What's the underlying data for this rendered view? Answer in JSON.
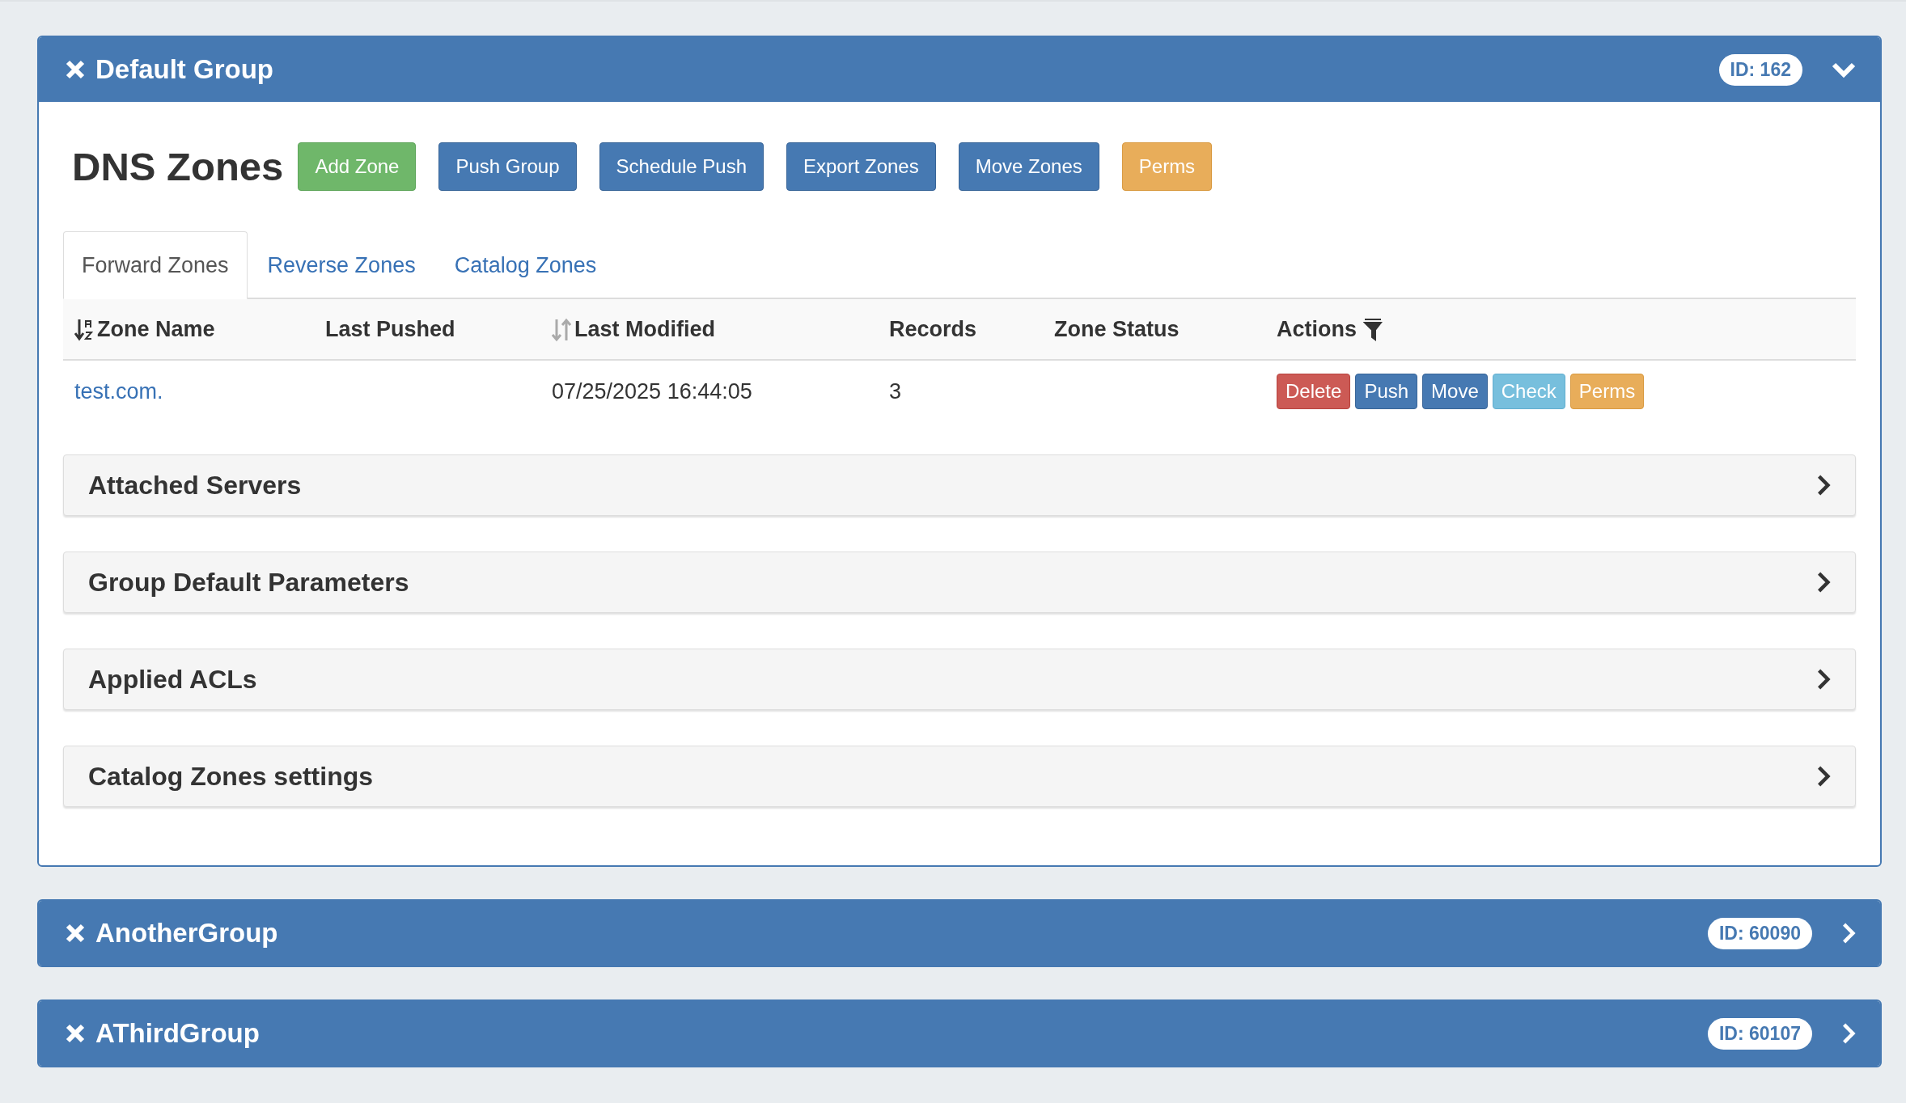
{
  "groups": [
    {
      "title": "Default Group",
      "id_badge": "ID: 162",
      "expanded": true,
      "content": {
        "heading": "DNS Zones",
        "buttons": [
          {
            "label": "Add Zone",
            "kind": "success"
          },
          {
            "label": "Push Group",
            "kind": "primary"
          },
          {
            "label": "Schedule Push",
            "kind": "primary"
          },
          {
            "label": "Export Zones",
            "kind": "primary"
          },
          {
            "label": "Move Zones",
            "kind": "primary"
          },
          {
            "label": "Perms",
            "kind": "warning"
          }
        ],
        "tabs": [
          {
            "label": "Forward Zones",
            "selected": true
          },
          {
            "label": "Reverse Zones",
            "selected": false
          },
          {
            "label": "Catalog Zones",
            "selected": false
          }
        ],
        "table": {
          "columns": [
            {
              "label": "Zone Name",
              "kind": "sorted"
            },
            {
              "label": "Last Pushed",
              "kind": "plain"
            },
            {
              "label": "Last Modified",
              "kind": "sortable"
            },
            {
              "label": "Records",
              "kind": "plain"
            },
            {
              "label": "Zone Status",
              "kind": "plain"
            },
            {
              "label": "Actions",
              "kind": "filter"
            }
          ],
          "rows": [
            {
              "zone_name": "test.com.",
              "last_pushed": "",
              "last_modified": "07/25/2025 16:44:05",
              "records": "3",
              "zone_status": "",
              "actions": [
                {
                  "label": "Delete",
                  "kind": "danger"
                },
                {
                  "label": "Push",
                  "kind": "primary"
                },
                {
                  "label": "Move",
                  "kind": "primary"
                },
                {
                  "label": "Check",
                  "kind": "info"
                },
                {
                  "label": "Perms",
                  "kind": "warning"
                }
              ]
            }
          ]
        },
        "sections": [
          {
            "title": "Attached Servers",
            "expanded": false
          },
          {
            "title": "Group Default Parameters",
            "expanded": false
          },
          {
            "title": "Applied ACLs",
            "expanded": false
          },
          {
            "title": "Catalog Zones settings",
            "expanded": false
          }
        ]
      }
    },
    {
      "title": "AnotherGroup",
      "id_badge": "ID: 60090",
      "expanded": false
    },
    {
      "title": "AThirdGroup",
      "id_badge": "ID: 60107",
      "expanded": false
    }
  ]
}
